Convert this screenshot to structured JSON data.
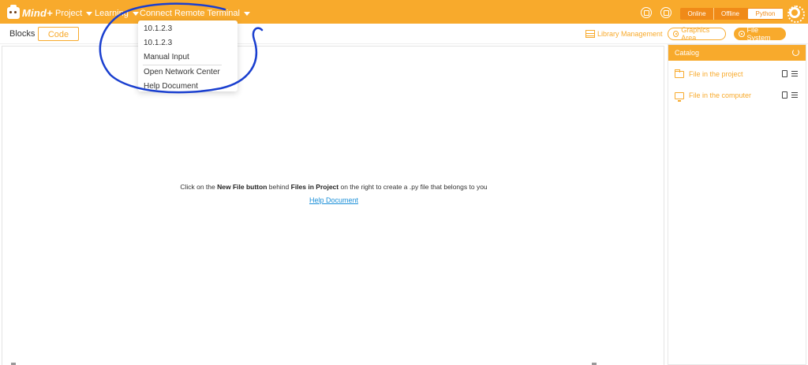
{
  "header": {
    "logo_text": "Mind+",
    "menus": [
      "Project",
      "Learning",
      "Connect Remote Terminal"
    ],
    "modes": {
      "online": "Online",
      "offline": "Offline",
      "python": "Python"
    },
    "accent": "#f8aa2c"
  },
  "toolbar": {
    "tabs": {
      "blocks": "Blocks",
      "code": "Code"
    },
    "library_management": "Library Management",
    "graphics_area": "Graphics Area",
    "file_system": "File System"
  },
  "dropdown": {
    "items": [
      "10.1.2.3",
      "10.1.2.3",
      "Manual Input",
      "Open Network Center",
      "Help Document"
    ]
  },
  "editor": {
    "hint_pre": "Click on the ",
    "hint_bold1": "New File button",
    "hint_mid": " behind ",
    "hint_bold2": "Files in Project",
    "hint_post": " on the right to create a .py file that belongs to you",
    "help_link": "Help Document"
  },
  "catalog": {
    "title": "Catalog",
    "rows": [
      "File in the project",
      "File in the computer"
    ]
  },
  "icons": [
    "robot-logo-icon",
    "caret-down-icon",
    "circle-icon",
    "gear-icon",
    "grid-icon",
    "palette-icon",
    "folder-icon",
    "monitor-icon",
    "new-file-icon",
    "menu-icon",
    "refresh-icon"
  ]
}
